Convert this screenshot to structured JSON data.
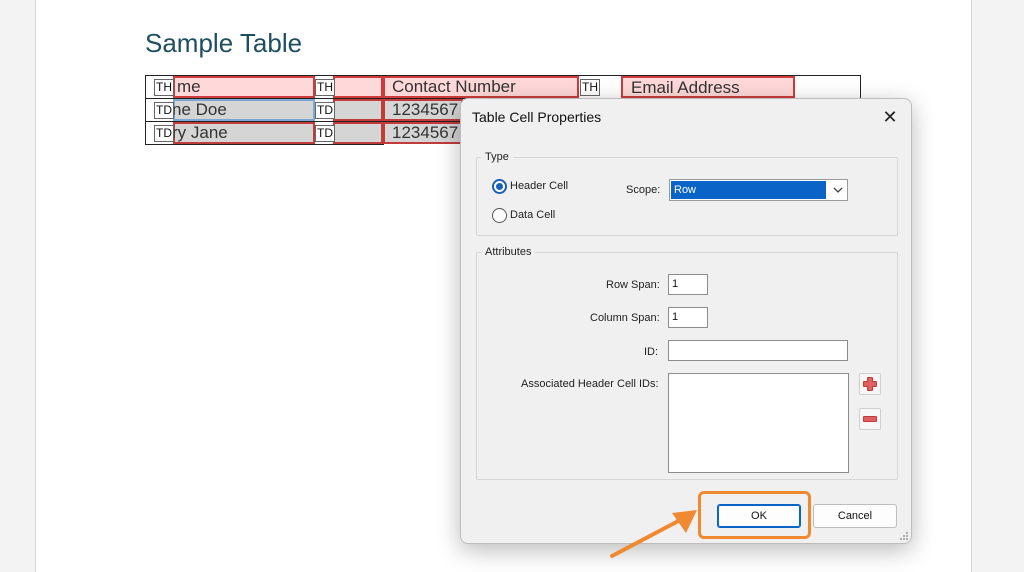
{
  "document": {
    "title": "Sample Table",
    "table": {
      "header_row": {
        "name_fragment": "me",
        "contact": "Contact Number",
        "email": "Email Address"
      },
      "rows": [
        {
          "name_fragment": "ne Doe",
          "contact_fragment": "1234567"
        },
        {
          "name_fragment": "ry Jane",
          "contact_fragment": "1234567"
        }
      ],
      "tags": {
        "th": "TH",
        "td": "TD"
      }
    }
  },
  "dialog": {
    "title": "Table Cell Properties",
    "close_glyph": "✕",
    "type_group": {
      "legend": "Type",
      "header_cell_label": "Header Cell",
      "data_cell_label": "Data Cell",
      "selected": "Header Cell",
      "scope_label": "Scope:",
      "scope_value": "Row"
    },
    "attributes_group": {
      "legend": "Attributes",
      "row_span_label": "Row Span:",
      "row_span_value": "1",
      "column_span_label": "Column Span:",
      "column_span_value": "1",
      "id_label": "ID:",
      "id_value": "",
      "assoc_label": "Associated Header Cell IDs:"
    },
    "ok_label": "OK",
    "cancel_label": "Cancel"
  },
  "colors": {
    "annotation": "#ef8a32",
    "accent": "#0a64c8",
    "title": "#1f4e5f"
  }
}
